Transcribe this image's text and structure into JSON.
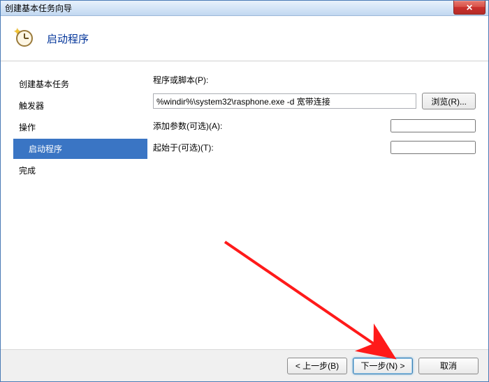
{
  "window": {
    "title": "创建基本任务向导",
    "close_symbol": "✕"
  },
  "header": {
    "title": "启动程序"
  },
  "sidebar": {
    "step1": "创建基本任务",
    "step2": "触发器",
    "step3": "操作",
    "step3a": "启动程序",
    "step4": "完成"
  },
  "form": {
    "program_label": "程序或脚本(P):",
    "program_value": "%windir%\\system32\\rasphone.exe -d 宽带连接",
    "browse_label": "浏览(R)...",
    "args_label": "添加参数(可选)(A):",
    "args_value": "",
    "startin_label": "起始于(可选)(T):",
    "startin_value": ""
  },
  "footer": {
    "back_label": "< 上一步(B)",
    "next_label": "下一步(N) >",
    "cancel_label": "取消"
  }
}
